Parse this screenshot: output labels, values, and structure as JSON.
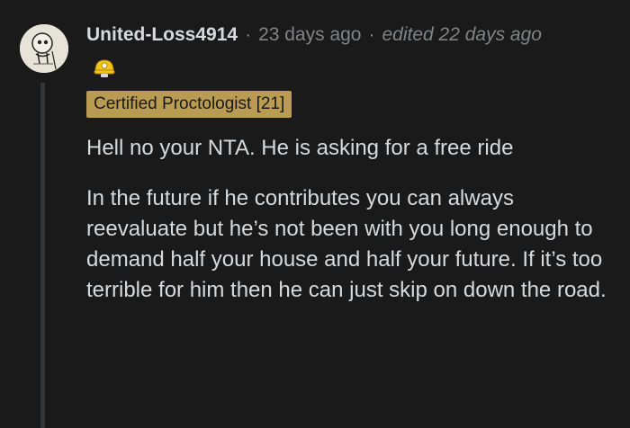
{
  "comment": {
    "username": "United-Loss4914",
    "separator": "·",
    "timestamp": "23 days ago",
    "edited": "edited 22 days ago",
    "avatar_icon": "snoo-avatar-icon",
    "award_icon": "award-helmet-icon",
    "flair": "Certified Proctologist [21]",
    "flair_color": "#ba9b52",
    "paragraphs": [
      "Hell no your NTA. He is asking for a free ride",
      "In the future if he contributes you can always reevaluate but he’s not been with you long enough to demand half your house and half your future. If it’s too terrible for him then he can just skip on down the road."
    ]
  }
}
